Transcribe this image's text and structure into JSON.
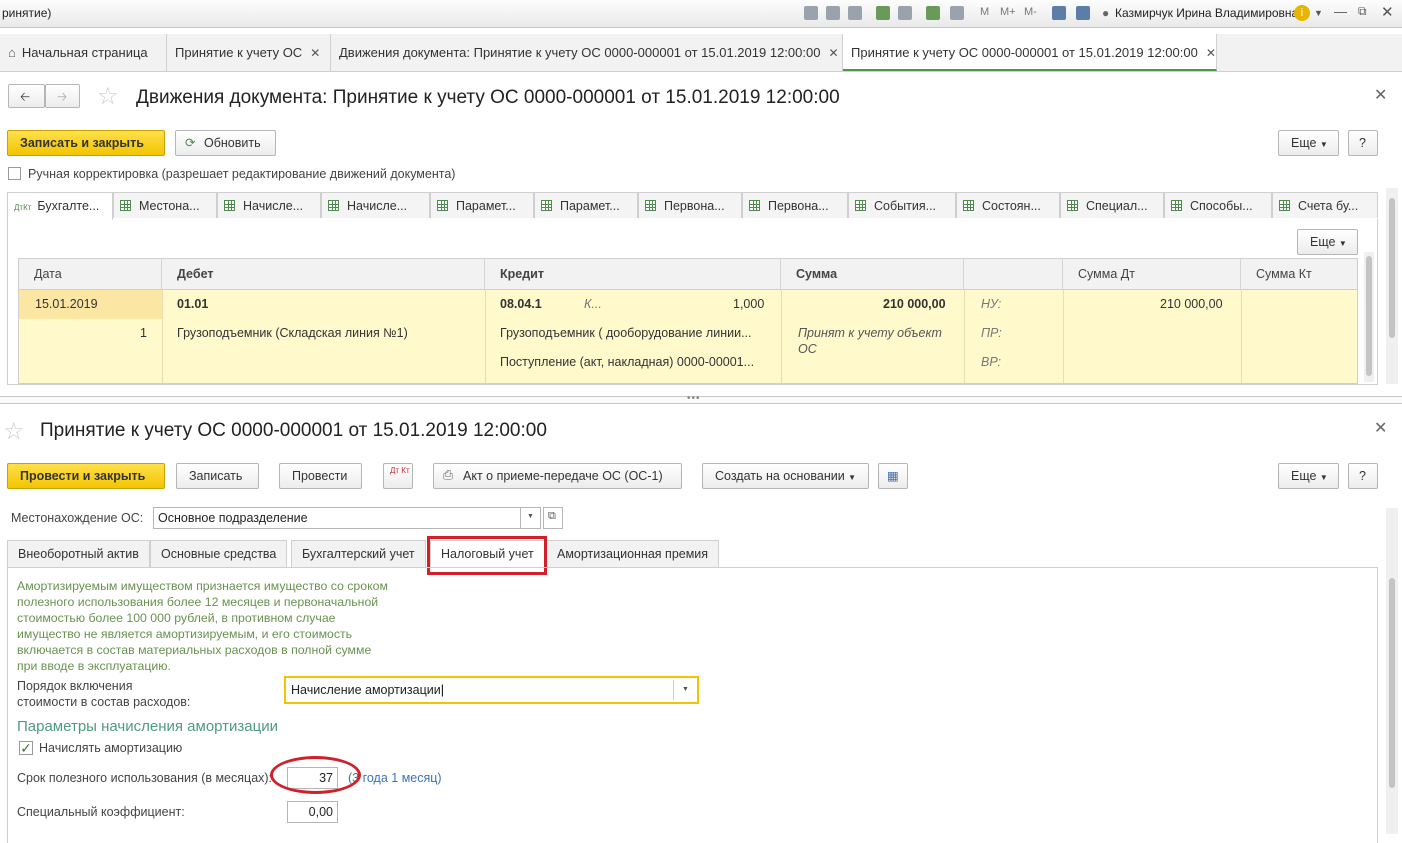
{
  "titlebar": {
    "title": "ринятие)",
    "toolbar_labels": [
      "M",
      "M+",
      "M-"
    ],
    "user_name": "Казмирчук Ирина Владимировна"
  },
  "open_tabs": [
    {
      "label": "Начальная страница",
      "closable": false
    },
    {
      "label": "Принятие к учету ОС",
      "closable": true
    },
    {
      "label": "Движения документа: Принятие к учету ОС 0000-000001 от 15.01.2019 12:00:00",
      "closable": true
    },
    {
      "label": "Принятие к учету ОС 0000-000001 от 15.01.2019 12:00:00",
      "closable": true,
      "active": true
    }
  ],
  "movements": {
    "title": "Движения документа: Принятие к учету ОС 0000-000001 от 15.01.2019 12:00:00",
    "save_close_label": "Записать и закрыть",
    "refresh_label": "Обновить",
    "more_label": "Еще",
    "help_label": "?",
    "manual_checkbox_label": "Ручная корректировка (разрешает редактирование движений документа)",
    "register_tabs": [
      "Бухгалте...",
      "Местона...",
      "Начисле...",
      "Начисле...",
      "Парамет...",
      "Парамет...",
      "Первона...",
      "Первона...",
      "События...",
      "Состоян...",
      "Специал...",
      "Способы...",
      "Счета бу..."
    ],
    "grid_more_label": "Еще",
    "columns": [
      "Дата",
      "Дебет",
      "Кредит",
      "Сумма",
      "",
      "Сумма Дт",
      "Сумма Кт"
    ],
    "row": {
      "date": "15.01.2019",
      "line_no": "1",
      "debit_account": "01.01",
      "debit_subconto": "Грузоподъемник (Складская линия №1)",
      "credit_account": "08.04.1",
      "credit_qty_label": "К...",
      "credit_qty": "1,000",
      "credit_subconto1": "Грузоподъемник ( дооборудование линии...",
      "credit_subconto2": "Поступление (акт, накладная) 0000-00001...",
      "sum": "210 000,00",
      "content_line1": "Принят к учету объект",
      "content_line2": "ОС",
      "nu_label": "НУ:",
      "pr_label": "ПР:",
      "vr_label": "ВР:",
      "sum_dt": "210 000,00"
    }
  },
  "document": {
    "title": "Принятие к учету ОС 0000-000001 от 15.01.2019 12:00:00",
    "post_close_label": "Провести и закрыть",
    "save_label": "Записать",
    "post_label": "Провести",
    "dt_kt_label": "Дт Кт",
    "print_act_label": "Акт о приеме-передаче ОС (ОС-1)",
    "create_based_label": "Создать на основании",
    "more_label": "Еще",
    "help_label": "?",
    "location_label": "Местонахождение ОС:",
    "location_value": "Основное подразделение",
    "tabs": [
      "Внеоборотный актив",
      "Основные средства",
      "Бухгалтерский учет",
      "Налоговый учет",
      "Амортизационная премия"
    ],
    "active_tab": "Налоговый учет",
    "info_text": [
      "Амортизируемым имуществом признается имущество со сроком",
      "полезного использования более 12 месяцев и первоначальной",
      "стоимостью более 100 000 рублей, в противном случае",
      "имущество не является амортизируемым, и его стоимость",
      "включается в состав материальных расходов в полной сумме",
      "при вводе в эксплуатацию."
    ],
    "order_label_line1": "Порядок включения",
    "order_label_line2": "стоимости в состав расходов:",
    "order_value": "Начисление амортизации",
    "params_heading": "Параметры начисления амортизации",
    "accrue_label": "Начислять амортизацию",
    "accrue_checked": true,
    "life_label": "Срок полезного использования (в месяцах):",
    "life_value": "37",
    "life_hint": "(3 года 1 месяц)",
    "coef_label": "Специальный коэффициент:",
    "coef_value": "0,00"
  },
  "colors": {
    "accent_yellow": "#f5c800",
    "selection_row": "#fff9cc",
    "highlight_red": "#d0202a",
    "green_text": "#6b9150",
    "hint_blue": "#3b74b8"
  }
}
